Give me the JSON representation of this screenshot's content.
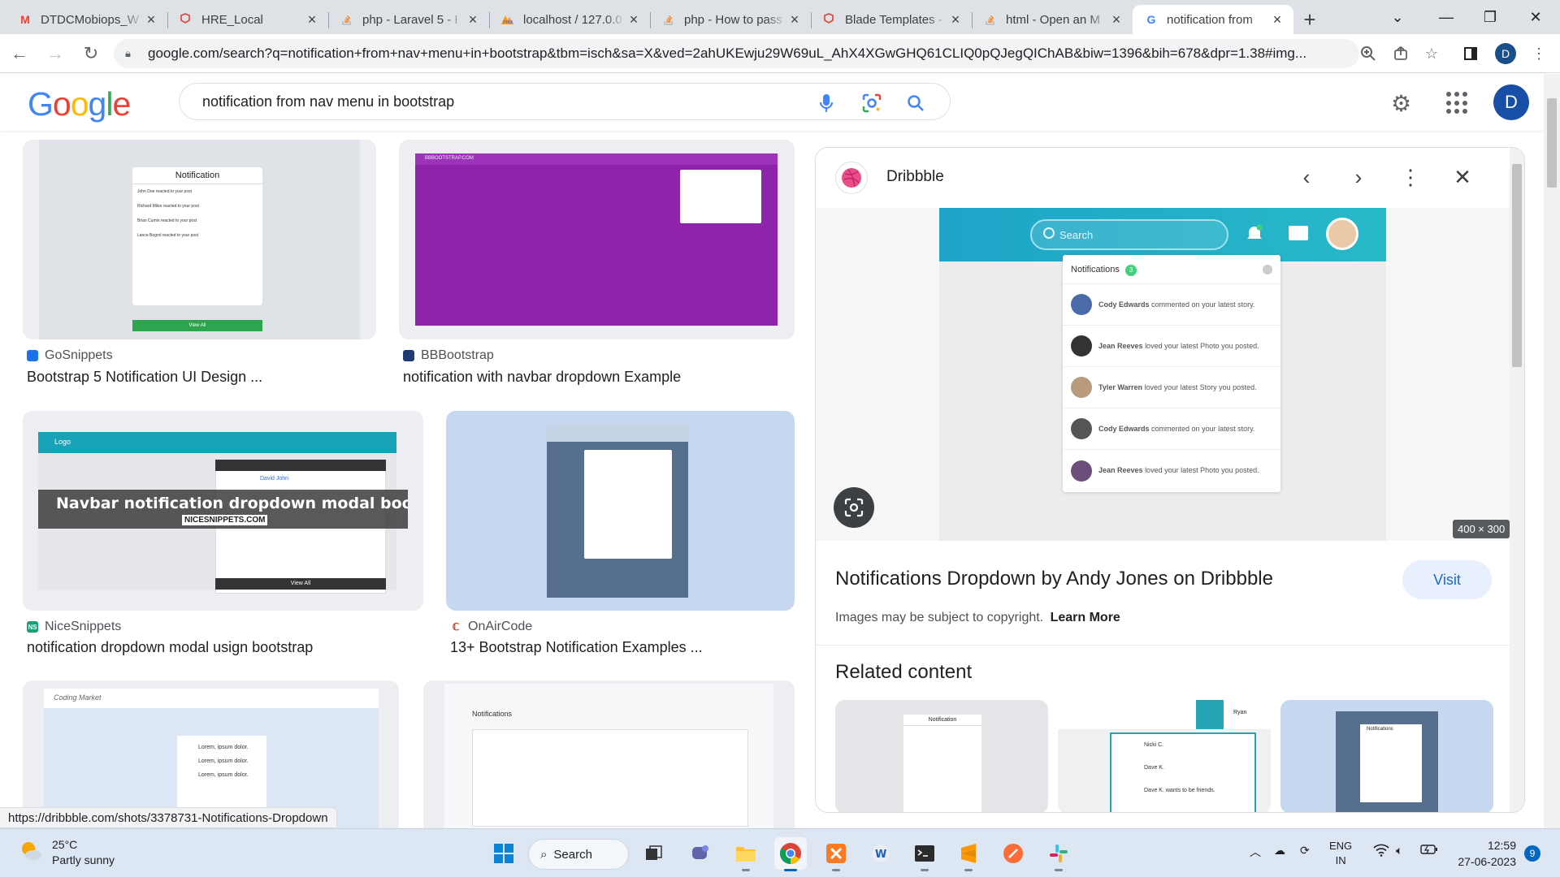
{
  "browser": {
    "tabs": [
      {
        "title": "DTDCMobiops_W",
        "icon": "gmail-icon",
        "active": false
      },
      {
        "title": "HRE_Local",
        "icon": "laravel-icon",
        "active": false
      },
      {
        "title": "php - Laravel 5 - I",
        "icon": "stackoverflow-icon",
        "active": false
      },
      {
        "title": "localhost / 127.0.0",
        "icon": "phpmyadmin-icon",
        "active": false
      },
      {
        "title": "php - How to pass",
        "icon": "stackoverflow-icon",
        "active": false
      },
      {
        "title": "Blade Templates -",
        "icon": "laravel-icon",
        "active": false
      },
      {
        "title": "html - Open an M",
        "icon": "stackoverflow-icon",
        "active": false
      },
      {
        "title": "notification from",
        "icon": "google-icon",
        "active": true
      }
    ],
    "url": "google.com/search?q=notification+from+nav+menu+in+bootstrap&tbm=isch&sa=X&ved=2ahUKEwju29W69uL_AhX4XGwGHQ61CLIQ0pQJegQIChAB&biw=1396&bih=678&dpr=1.38#img...",
    "profile_initial": "D"
  },
  "google": {
    "logo_letters": [
      "G",
      "o",
      "o",
      "g",
      "l",
      "e"
    ],
    "query": "notification from nav menu in bootstrap",
    "avatar_initial": "D"
  },
  "results": [
    {
      "source": "GoSnippets",
      "title": "Bootstrap 5 Notification UI Design ..."
    },
    {
      "source": "BBBootstrap",
      "title": "notification with navbar dropdown Example"
    },
    {
      "source": "NiceSnippets",
      "title": "notification dropdown modal usign bootstrap"
    },
    {
      "source": "OnAirCode",
      "title": "13+ Bootstrap Notification Examples ..."
    }
  ],
  "thumbs": {
    "go_header": "Notification",
    "go_items": [
      "John Doe reacted to your post",
      "Richard Miles reacted to your post",
      "Brian Cumin reacted to your post",
      "Lance Bogrol reacted to your post"
    ],
    "go_viewall": "View All",
    "bb_brand": "BBBOOTSTRAP.COM",
    "nice_logo": "Logo",
    "nice_banner": "Navbar notification dropdown modal bootstrap",
    "nice_site": "NICESNIPPETS.COM",
    "nice_name": "David John",
    "nice_view": "View All",
    "coding_market": "Coding Market",
    "coding_items": [
      "Lorem, ipsum dolor.",
      "Lorem, ipsum dolor.",
      "Lorem, ipsum dolor."
    ],
    "nav_title": "Notifications"
  },
  "panel": {
    "site": "Dribbble",
    "title": "Notifications Dropdown by Andy Jones on Dribbble",
    "visit_label": "Visit",
    "copyright": "Images may be subject to copyright.",
    "learn_more": "Learn More",
    "dims": "400 × 300",
    "related_label": "Related content",
    "preview": {
      "search_placeholder": "Search",
      "header": "Notifications",
      "count": "3",
      "items": [
        {
          "name": "Cody Edwards",
          "text": "commented on your latest story."
        },
        {
          "name": "Jean Reeves",
          "text": "loved your latest Photo you posted."
        },
        {
          "name": "Tyler Warren",
          "text": "loved your latest Story you posted."
        },
        {
          "name": "Cody Edwards",
          "text": "commented on your latest story."
        },
        {
          "name": "Jean Reeves",
          "text": "loved your latest Photo you posted."
        }
      ]
    },
    "related_thumbs": {
      "r1_header": "Notification",
      "r2_names": [
        "Nicki C.",
        "Dave K.",
        "Dave K. wants to be friends."
      ],
      "r2_user": "Ryan",
      "r3_header": "Notifications"
    }
  },
  "status_url": "https://dribbble.com/shots/3378731-Notifications-Dropdown",
  "taskbar": {
    "temp": "25°C",
    "weather": "Partly sunny",
    "search_label": "Search",
    "lang": "ENG",
    "region": "IN",
    "time": "12:59",
    "date": "27-06-2023",
    "notification_count": "9"
  }
}
